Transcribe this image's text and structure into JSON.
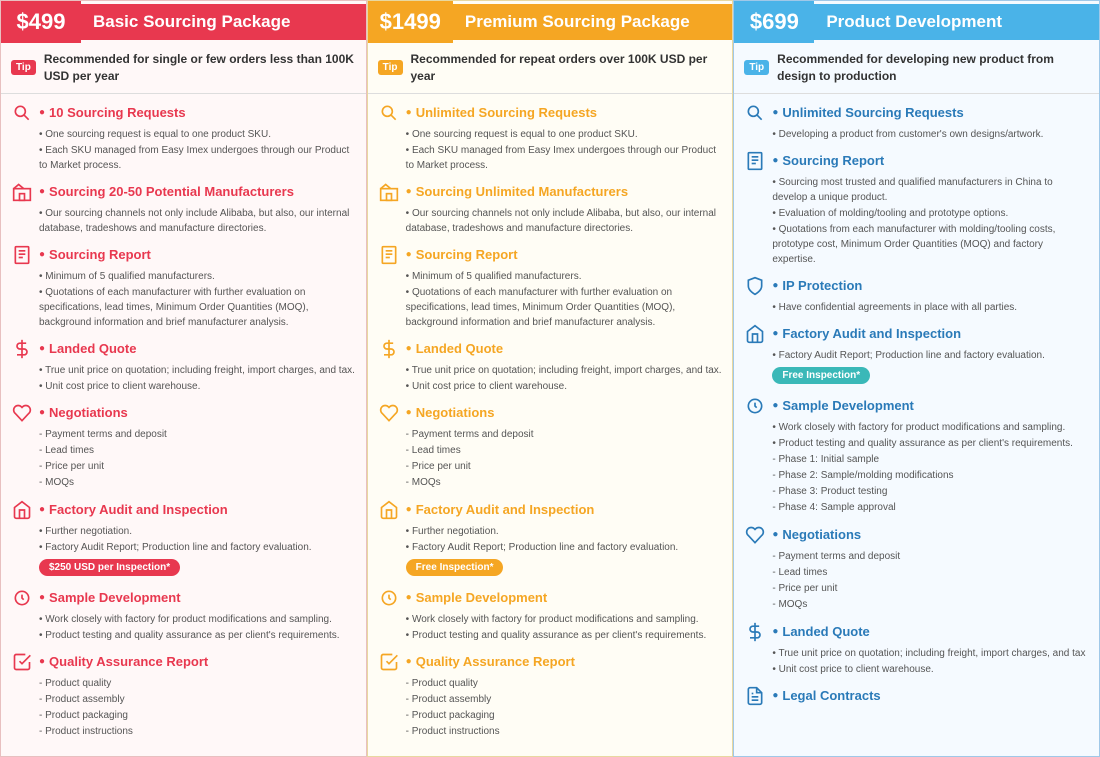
{
  "columns": [
    {
      "id": "basic",
      "price": "$499",
      "title": "Basic Sourcing Package",
      "colorClass": "red",
      "tipText": "Recommended for single or few orders less than 100K USD per year",
      "features": [
        {
          "icon": "search",
          "title": "10 Sourcing Requests",
          "bullets": [
            "One sourcing request is equal to one product SKU.",
            "Each SKU managed from Easy Imex undergoes through our Product to Market process."
          ]
        },
        {
          "icon": "factory",
          "title": "Sourcing 20-50 Potential Manufacturers",
          "bullets": [
            "Our sourcing channels not only include Alibaba, but also, our internal database, tradeshows and manufacture directories."
          ]
        },
        {
          "icon": "report",
          "title": "Sourcing Report",
          "bullets": [
            "Minimum of 5 qualified manufacturers.",
            "Quotations of each manufacturer with further evaluation on specifications, lead times, Minimum Order Quantities (MOQ), background information and brief manufacturer analysis."
          ]
        },
        {
          "icon": "dollar",
          "title": "Landed Quote",
          "bullets": [
            "True unit price on quotation; including freight, import charges, and tax.",
            "Unit cost price to client warehouse."
          ]
        },
        {
          "icon": "handshake",
          "title": "Negotiations",
          "subs": [
            "Payment terms and deposit",
            "Lead times",
            "Price per unit",
            "MOQs"
          ]
        },
        {
          "icon": "factory2",
          "title": "Factory Audit and Inspection",
          "bullets": [
            "Further negotiation.",
            "Factory Audit Report; Production line and factory evaluation."
          ],
          "badge": "$250 USD per Inspection*",
          "badgeClass": "red"
        },
        {
          "icon": "sample",
          "title": "Sample Development",
          "bullets": [
            "Work closely with factory for product modifications and sampling.",
            "Product testing and quality assurance as per client's requirements."
          ]
        },
        {
          "icon": "qa",
          "title": "Quality Assurance Report",
          "subs": [
            "Product quality",
            "Product assembly",
            "Product packaging",
            "Product instructions"
          ]
        }
      ]
    },
    {
      "id": "premium",
      "price": "$1499",
      "title": "Premium Sourcing Package",
      "colorClass": "orange",
      "tipText": "Recommended for repeat orders over 100K USD per year",
      "features": [
        {
          "icon": "search",
          "title": "Unlimited Sourcing Requests",
          "bullets": [
            "One sourcing request is equal to one product SKU.",
            "Each SKU managed from Easy Imex undergoes through our Product to Market process."
          ]
        },
        {
          "icon": "factory",
          "title": "Sourcing Unlimited Manufacturers",
          "bullets": [
            "Our sourcing channels not only include Alibaba, but also, our internal database, tradeshows and manufacture directories."
          ]
        },
        {
          "icon": "report",
          "title": "Sourcing Report",
          "bullets": [
            "Minimum of 5 qualified manufacturers.",
            "Quotations of each manufacturer with further evaluation on specifications, lead times, Minimum Order Quantities (MOQ), background information and brief manufacturer analysis."
          ]
        },
        {
          "icon": "dollar",
          "title": "Landed Quote",
          "bullets": [
            "True unit price on quotation; including freight, import charges, and tax.",
            "Unit cost price to client warehouse."
          ]
        },
        {
          "icon": "handshake",
          "title": "Negotiations",
          "subs": [
            "Payment terms and deposit",
            "Lead times",
            "Price per unit",
            "MOQs"
          ]
        },
        {
          "icon": "factory2",
          "title": "Factory Audit and Inspection",
          "bullets": [
            "Further negotiation.",
            "Factory Audit Report; Production line and factory evaluation."
          ],
          "badge": "Free Inspection*",
          "badgeClass": "orange"
        },
        {
          "icon": "sample",
          "title": "Sample Development",
          "bullets": [
            "Work closely with factory for product modifications and sampling.",
            "Product testing and quality assurance as per client's requirements."
          ]
        },
        {
          "icon": "qa",
          "title": "Quality Assurance Report",
          "subs": [
            "Product quality",
            "Product assembly",
            "Product packaging",
            "Product instructions"
          ]
        }
      ]
    },
    {
      "id": "dev",
      "price": "$699",
      "title": "Product Development",
      "colorClass": "blue",
      "tipText": "Recommended for developing new product from design to production",
      "features": [
        {
          "icon": "search",
          "title": "Unlimited Sourcing Requests",
          "bullets": [
            "Developing a product from customer's own designs/artwork."
          ]
        },
        {
          "icon": "report",
          "title": "Sourcing Report",
          "bullets": [
            "Sourcing most trusted and qualified manufacturers in China to develop a unique product.",
            "Evaluation of molding/tooling and prototype options.",
            "Quotations from each manufacturer with molding/tooling costs, prototype cost, Minimum Order Quantities (MOQ) and factory expertise."
          ]
        },
        {
          "icon": "shield",
          "title": "IP Protection",
          "bullets": [
            "Have confidential agreements in place with all parties."
          ]
        },
        {
          "icon": "factory2",
          "title": "Factory Audit and Inspection",
          "bullets": [
            "Factory Audit Report; Production line and factory evaluation."
          ],
          "badge": "Free Inspection*",
          "badgeClass": "teal"
        },
        {
          "icon": "sample",
          "title": "Sample Development",
          "bullets": [
            "Work closely with factory for product modifications and sampling.",
            "Product testing and quality assurance as per client's requirements.",
            "Phase 1: Initial sample",
            "Phase 2: Sample/molding modifications",
            "Phase 3: Product testing",
            "Phase 4: Sample approval"
          ],
          "phaseList": true
        },
        {
          "icon": "handshake",
          "title": "Negotiations",
          "subs": [
            "Payment terms and deposit",
            "Lead times",
            "Price per unit",
            "MOQs"
          ]
        },
        {
          "icon": "dollar",
          "title": "Landed Quote",
          "bullets": [
            "True unit price on quotation; including freight, import charges, and tax",
            "Unit cost price to client warehouse."
          ]
        },
        {
          "icon": "contracts",
          "title": "Legal Contracts",
          "bullets": []
        }
      ]
    }
  ]
}
